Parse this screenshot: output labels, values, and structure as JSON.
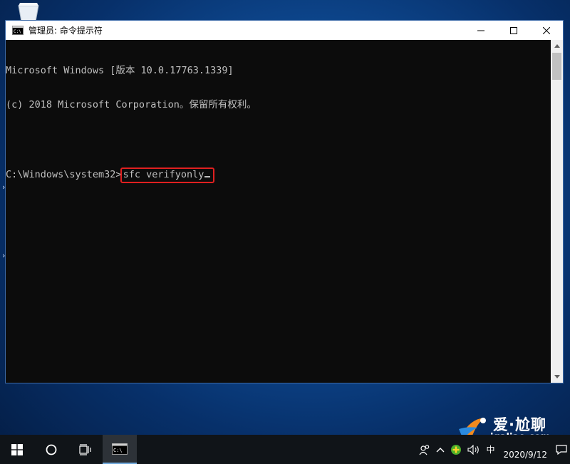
{
  "window": {
    "title": "管理员: 命令提示符"
  },
  "console": {
    "line1": "Microsoft Windows [版本 10.0.17763.1339]",
    "line2": "(c) 2018 Microsoft Corporation。保留所有权利。",
    "prompt": "C:\\Windows\\system32>",
    "command": "sfc verifyonly"
  },
  "watermark": {
    "brand": "爱·尬聊",
    "url": "igaliao.com"
  },
  "taskbar": {
    "ime": "中",
    "date": "2020/9/12"
  },
  "colors": {
    "console_bg": "#0c0c0c",
    "console_text": "#c0c0c0",
    "highlight": "#e02020",
    "taskbar": "#101418"
  }
}
